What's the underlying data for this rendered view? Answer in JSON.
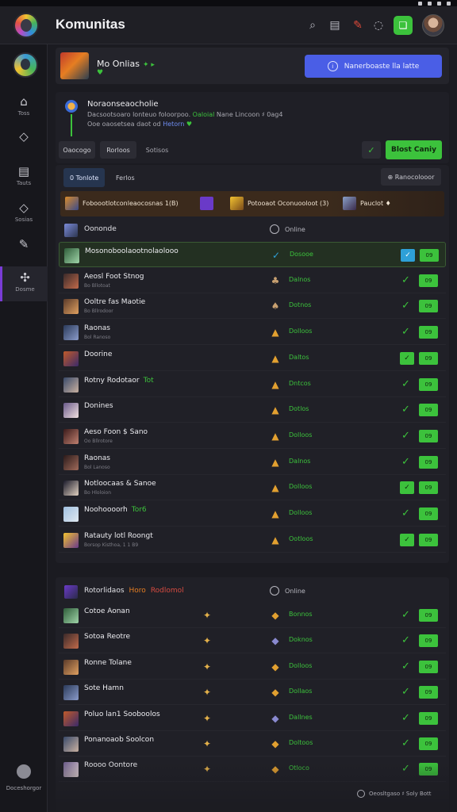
{
  "header": {
    "title": "Komunitas",
    "icons": [
      "search-icon",
      "document-icon",
      "pin-icon",
      "chat-icon",
      "green-chat-icon",
      "user-avatar"
    ]
  },
  "sidebar": {
    "items": [
      {
        "icon": "home-icon",
        "glyph": "⌂",
        "label": "Toss"
      },
      {
        "icon": "tag-icon",
        "glyph": "◇",
        "label": ""
      },
      {
        "icon": "grid-icon",
        "glyph": "▤",
        "label": "Tauts"
      },
      {
        "icon": "diamond-icon",
        "glyph": "◇",
        "label": "Sosias"
      },
      {
        "icon": "wrench-icon",
        "glyph": "✎",
        "label": ""
      },
      {
        "icon": "puzzle-icon",
        "glyph": "✣",
        "label": "Dosme"
      }
    ],
    "bottom_label": "Doceshorgor"
  },
  "top_card": {
    "name": "Mo Onlias",
    "name_tag": "✦ ▸",
    "sub": "♥",
    "button": "Nanerboaste lla latte"
  },
  "info_card": {
    "title": "Noraonseaocholie",
    "desc_a": "Dacsootsoaro lonteuo foloorpoo.",
    "desc_g": "Oaloial",
    "desc_b": "Nane Lincoon ♯ 0ag4",
    "desc2_a": "Ooe oaosetsea daot od",
    "desc2_b": "Hetorn",
    "desc2_c": "♥"
  },
  "filters": {
    "chip1": "Oaocogo",
    "chip2": "Rorloos",
    "chip3": "Sotisos",
    "action": "Blost Caniy"
  },
  "list1": {
    "tab_active": "0 Tonlote",
    "tab2": "Ferlos",
    "tab_right": "⊕ Ranocolooor",
    "banner": {
      "item1": "Foboootlotconleaocosnas 1(B)",
      "item2": "Potooaot Oconuooloot (3)",
      "item3": "Pauclot ♦"
    },
    "head_name": "Oononde",
    "head_status": "Online",
    "rows": [
      {
        "name": "Mosonoboolaootnolaolooo",
        "tag": "",
        "sub": "",
        "status": "Dosooe",
        "hl": true,
        "midglyph": "",
        "box": "blue"
      },
      {
        "name": "Aeosl Foot Stnog",
        "tag": "",
        "sub": "Bo Bllotoat",
        "status": "Dalnos",
        "hl": false,
        "midglyph": "",
        "box": ""
      },
      {
        "name": "Ooltre fas Maotie",
        "tag": "",
        "sub": "Bo Bllrodoor",
        "status": "Dotnos",
        "hl": false,
        "midglyph": "",
        "box": ""
      },
      {
        "name": "Raonas",
        "tag": "",
        "sub": "Bol Ranoso",
        "status": "Dolloos",
        "hl": false,
        "midglyph": "",
        "box": ""
      },
      {
        "name": "Doorine",
        "tag": "",
        "sub": "",
        "status": "Daltos",
        "hl": false,
        "midglyph": "",
        "box": "green"
      },
      {
        "name": "Rotny Rodotaor",
        "tag": "Tot",
        "sub": "",
        "status": "Dntcos",
        "hl": false,
        "midglyph": "",
        "box": ""
      },
      {
        "name": "Donines",
        "tag": "",
        "sub": "",
        "status": "Dotlos",
        "hl": false,
        "midglyph": "",
        "box": ""
      },
      {
        "name": "Aeso Foon $ Sano",
        "tag": "",
        "sub": "Oo Bllrotore",
        "status": "Dolloos",
        "hl": false,
        "midglyph": "",
        "box": ""
      },
      {
        "name": "Raonas",
        "tag": "",
        "sub": "Bol Lanoso",
        "status": "Dalnos",
        "hl": false,
        "midglyph": "",
        "box": ""
      },
      {
        "name": "Notloocaas & Sanoe",
        "tag": "",
        "sub": "Bo Hloloion",
        "status": "Dolloos",
        "hl": false,
        "midglyph": "",
        "box": "green"
      },
      {
        "name": "Noohoooorh",
        "tag": "Tor6",
        "sub": "",
        "status": "Dolloos",
        "hl": false,
        "midglyph": "",
        "box": ""
      },
      {
        "name": "Ratauty lotl Roongt",
        "tag": "",
        "sub": "Borsop Kisthoa, 1 1 B9",
        "status": "Ootloos",
        "hl": false,
        "midglyph": "",
        "box": "green"
      }
    ]
  },
  "list2": {
    "head_name": "Rotorlidaos",
    "head_tag1": "Horo",
    "head_tag2": "Rodlomol",
    "head_status": "Online",
    "rows": [
      {
        "name": "Cotoe Aonan",
        "status": "Bonnos"
      },
      {
        "name": "Sotoa Reotre",
        "status": "Doknos"
      },
      {
        "name": "Ronne Tolane",
        "status": "Dolloos"
      },
      {
        "name": "Sote Hamn",
        "status": "Dollaos"
      },
      {
        "name": "Poluo lan1 Sooboolos",
        "status": "Dallnes"
      },
      {
        "name": "Ponanoaob Soolcon",
        "status": "Doltoos"
      },
      {
        "name": "Roooo Oontore",
        "status": "Otloco"
      }
    ]
  },
  "footer": {
    "text": "Oeosltgaso ♯ Soly Bott"
  },
  "pill_text": "09"
}
